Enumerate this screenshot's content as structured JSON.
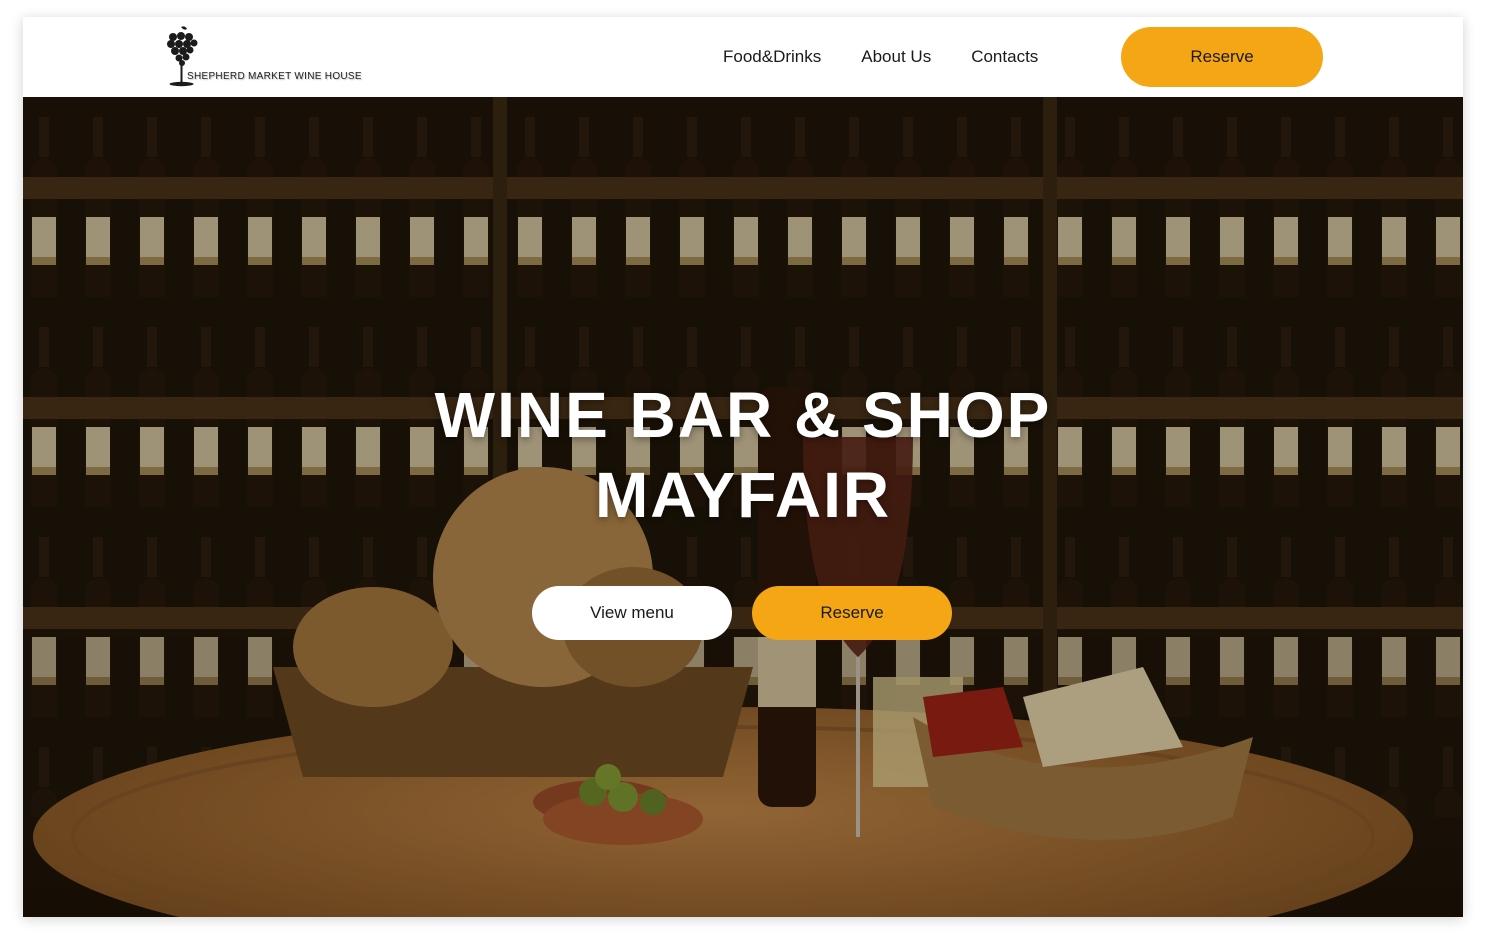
{
  "header": {
    "logo_text": "SHEPHERD MARKET WINE HOUSE",
    "nav": [
      "Food&Drinks",
      "About Us",
      "Contacts"
    ],
    "reserve_label": "Reserve"
  },
  "hero": {
    "title_line1": "WINE BAR & SHOP",
    "title_line2": "MAYFAIR",
    "view_menu_label": "View menu",
    "reserve_label": "Reserve"
  },
  "colors": {
    "accent": "#f5a614",
    "text_dark": "#1a1a1a",
    "hero_text": "#ffffff"
  },
  "icons": {
    "logo": "grape-wineglass-icon"
  }
}
